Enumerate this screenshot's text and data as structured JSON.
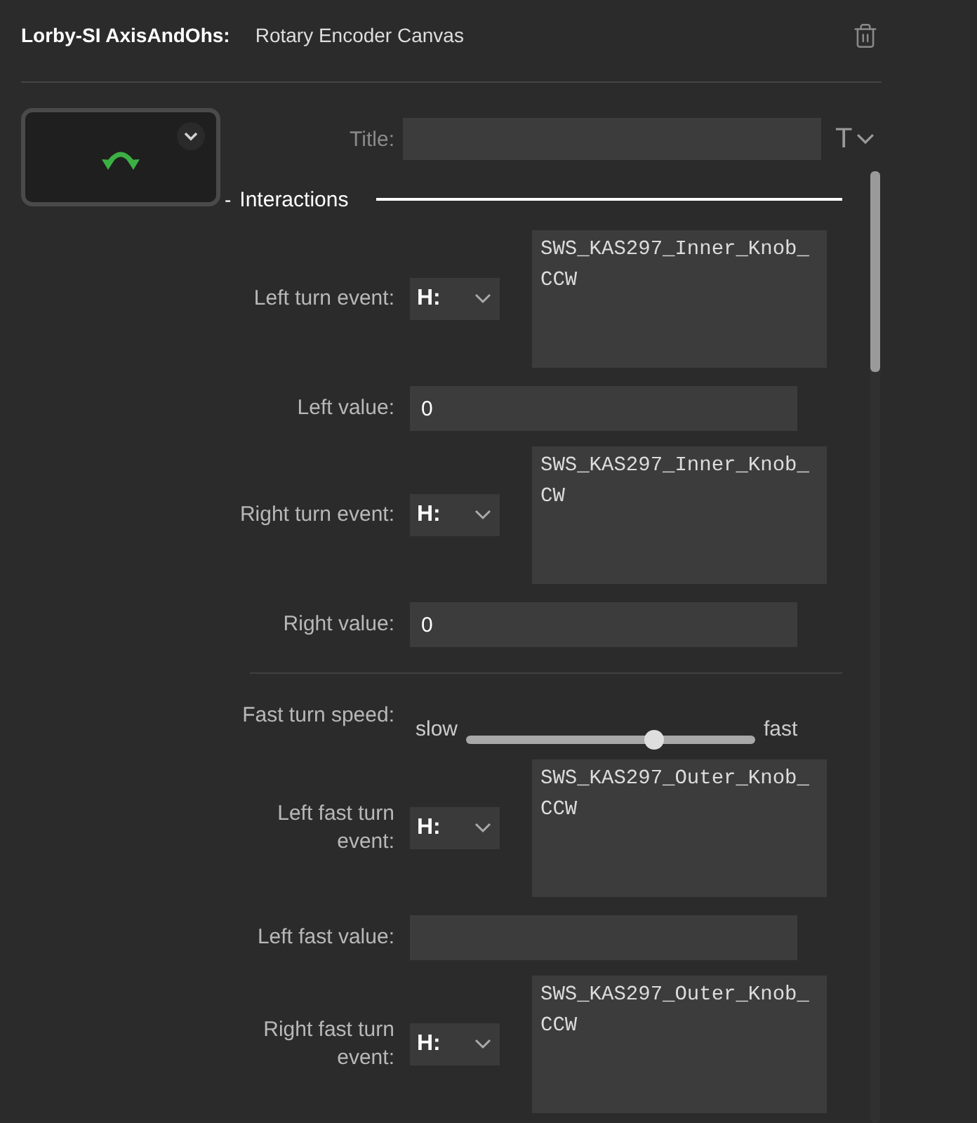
{
  "header": {
    "app_name": "Lorby-SI AxisAndOhs:",
    "page_title": "Rotary Encoder Canvas"
  },
  "title_field": {
    "label": "Title:"
  },
  "format_button": {
    "label": "T"
  },
  "section": {
    "toggle": "-",
    "title": "Interactions"
  },
  "fields": [
    {
      "kind": "event",
      "label": "Left turn event:",
      "event_type": "H:",
      "value": "SWS_KAS297_Inner_Knob_CCW"
    },
    {
      "kind": "value",
      "label": "Left value:",
      "value": "0"
    },
    {
      "kind": "event",
      "label": "Right turn event:",
      "event_type": "H:",
      "value": "SWS_KAS297_Inner_Knob_CW"
    },
    {
      "kind": "value",
      "label": "Right value:",
      "value": "0"
    },
    {
      "kind": "divider"
    },
    {
      "kind": "slider",
      "label": "Fast turn speed:",
      "min_label": "slow",
      "max_label": "fast",
      "level": 0.65
    },
    {
      "kind": "event",
      "label": "Left fast turn event:",
      "event_type": "H:",
      "value": "SWS_KAS297_Outer_Knob_CCW"
    },
    {
      "kind": "value",
      "label": "Left fast value:"
    },
    {
      "kind": "event",
      "label": "Right fast turn event:",
      "event_type": "H:",
      "value": "SWS_KAS297_Outer_Knob_CCW"
    }
  ]
}
